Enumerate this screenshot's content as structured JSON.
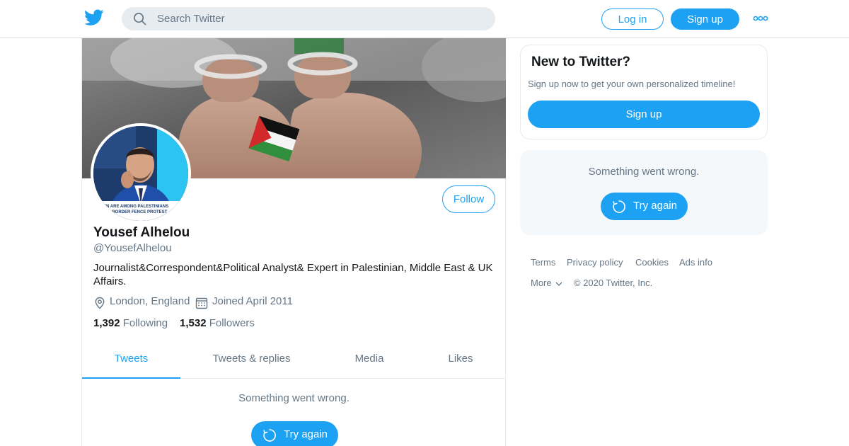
{
  "header": {
    "search_placeholder": "Search Twitter",
    "login_label": "Log in",
    "signup_label": "Sign up"
  },
  "profile": {
    "display_name": "Yousef Alhelou",
    "handle": "@YousefAlhelou",
    "bio": "Journalist&Correspondent&Political Analyst& Expert in Palestinian, Middle East & UK Affairs.",
    "location": "London, England",
    "joined": "Joined April 2011",
    "following_count": "1,392",
    "following_label": "Following",
    "followers_count": "1,532",
    "followers_label": "Followers",
    "follow_label": "Follow",
    "avatar_caption_line1": "EN ARE AMONG PALESTINIANS",
    "avatar_caption_line2": "ING BORDER FENCE PROTEST"
  },
  "tabs": [
    {
      "label": "Tweets",
      "active": true
    },
    {
      "label": "Tweets & replies",
      "active": false
    },
    {
      "label": "Media",
      "active": false
    },
    {
      "label": "Likes",
      "active": false
    }
  ],
  "timeline": {
    "error_text": "Something went wrong.",
    "retry_label": "Try again"
  },
  "sidebar": {
    "signup_card": {
      "title": "New to Twitter?",
      "subtitle": "Sign up now to get your own personalized timeline!",
      "button_label": "Sign up"
    },
    "error_card": {
      "error_text": "Something went wrong.",
      "retry_label": "Try again"
    },
    "footer_links": [
      "Terms",
      "Privacy policy",
      "Cookies",
      "Ads info",
      "More"
    ],
    "copyright": "© 2020 Twitter, Inc."
  },
  "colors": {
    "brand_blue": "#1da1f2",
    "muted_text": "#657786",
    "primary_text": "#14171a",
    "light_bg": "#f5f8fa"
  },
  "icons": [
    "twitter-bird-icon",
    "search-icon",
    "more-dots-icon",
    "location-pin-icon",
    "calendar-icon",
    "refresh-icon",
    "chevron-down-icon"
  ]
}
